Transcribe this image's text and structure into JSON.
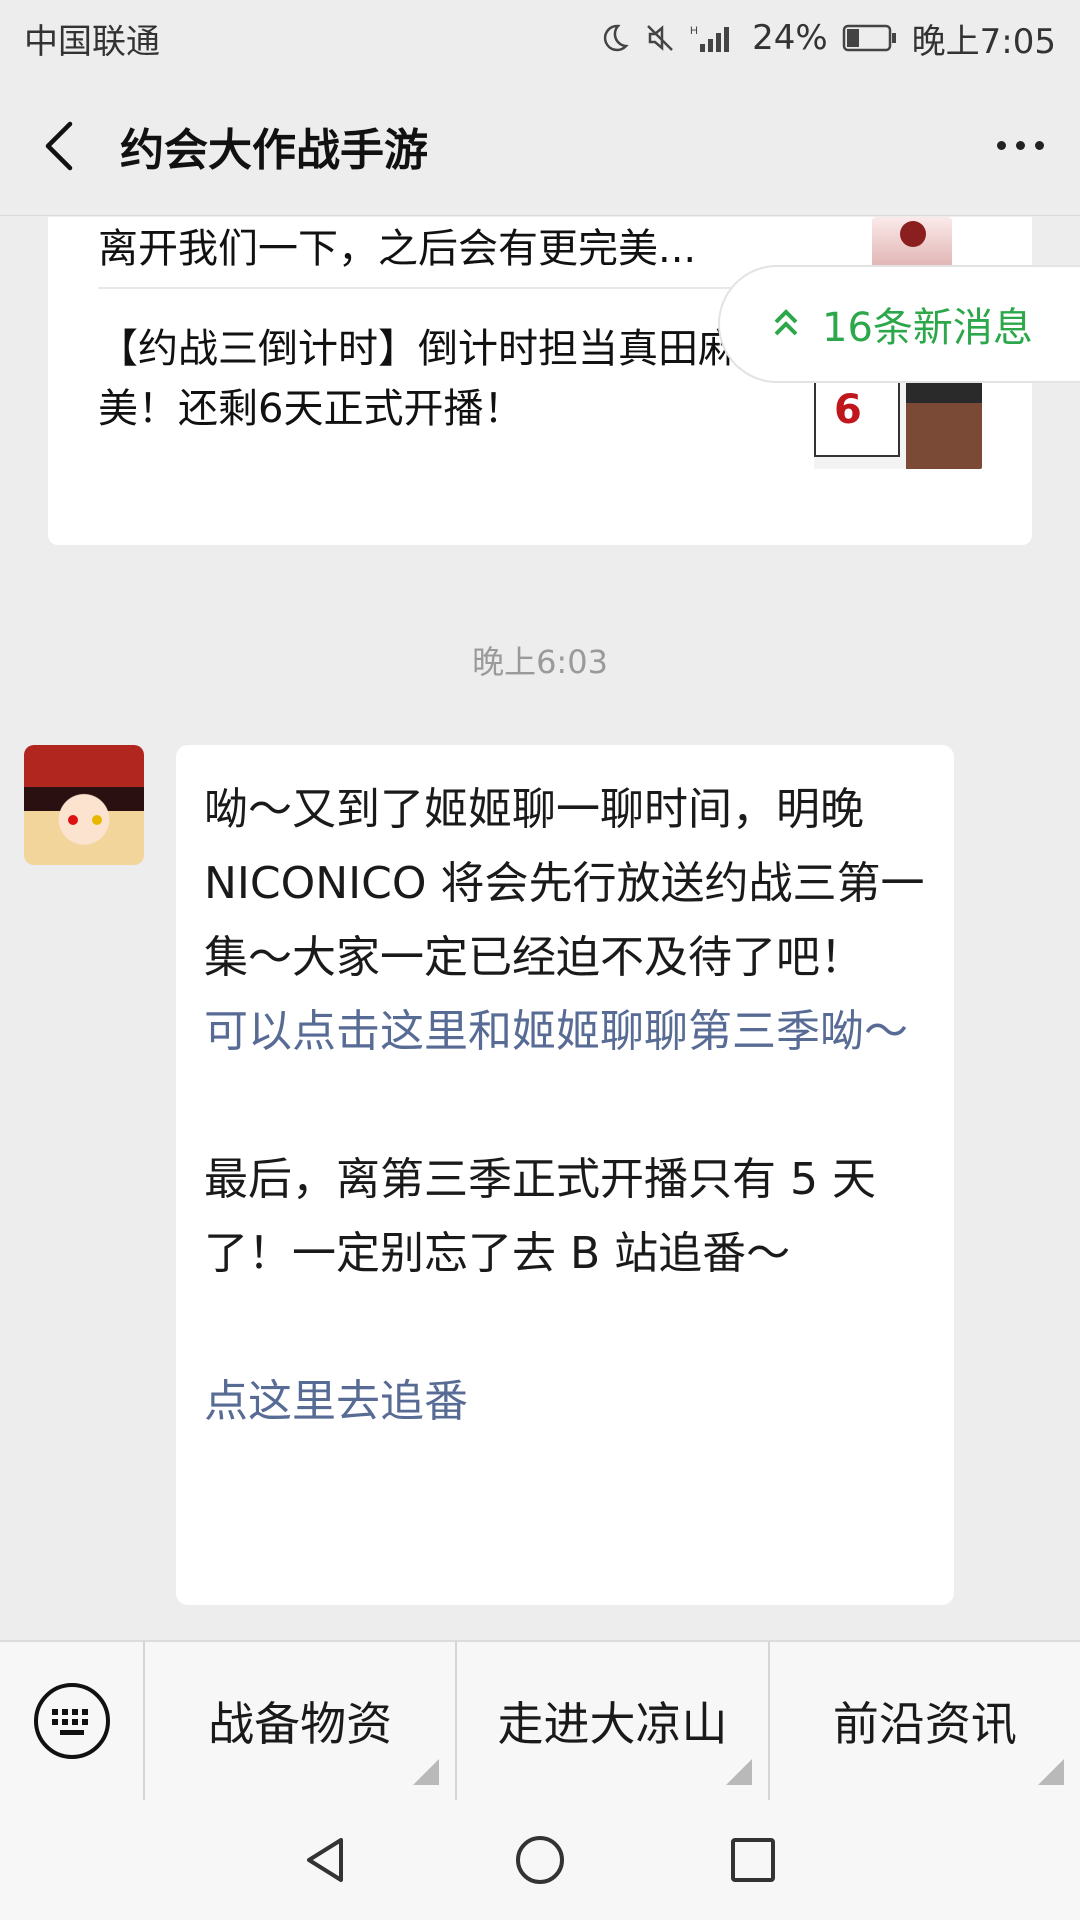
{
  "status_bar": {
    "carrier": "中国联通",
    "battery_percent": "24%",
    "time": "晚上7:05",
    "icons": [
      "moon-icon",
      "mute-icon",
      "signal-icon",
      "battery-icon"
    ]
  },
  "header": {
    "title": "约会大作战手游",
    "back_icon": "chevron-left-icon",
    "more_icon": "more-dots-icon"
  },
  "article_card": {
    "items": [
      {
        "text": "离开我们一下，之后会有更完美..."
      },
      {
        "text": "【约战三倒计时】倒计时担当真田麻美！还剩6天正式开播！",
        "thumb_number": "6"
      }
    ]
  },
  "new_messages": {
    "label": "16条新消息",
    "icon": "double-chevron-up-icon"
  },
  "chat": {
    "timestamp": "晚上6:03",
    "message": {
      "paragraph1": "呦～又到了姬姬聊一聊时间，明晚 NICONICO 将会先行放送约战三第一集～大家一定已经迫不及待了吧！",
      "link1": "可以点击这里和姬姬聊聊第三季呦～",
      "paragraph2": "最后，离第三季正式开播只有 5 天了！一定别忘了去 B 站追番～",
      "link2": "点这里去追番"
    }
  },
  "menu": {
    "keyboard_icon": "keyboard-icon",
    "items": [
      {
        "label": "战备物资"
      },
      {
        "label": "走进大凉山"
      },
      {
        "label": "前沿资讯"
      }
    ]
  },
  "colors": {
    "background": "#ededed",
    "link": "#576b95",
    "accent_green": "#2ca84a"
  }
}
